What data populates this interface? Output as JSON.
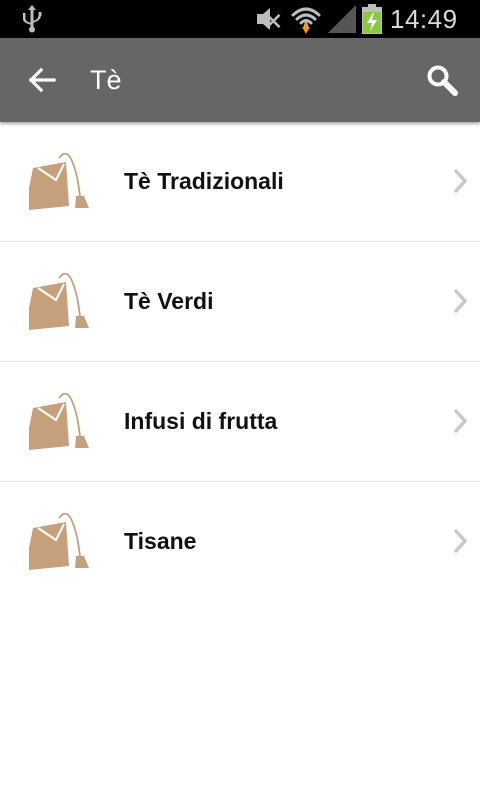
{
  "statusbar": {
    "time": "14:49",
    "icons": [
      "usb-icon",
      "mute-icon",
      "wifi-icon",
      "signal-icon",
      "battery-charging-icon"
    ]
  },
  "actionbar": {
    "title": "Tè",
    "back_icon": "arrow-left-icon",
    "search_icon": "search-icon"
  },
  "colors": {
    "statusbar_bg": "#000000",
    "actionbar_bg": "#666666",
    "teabag": "#c4a07c",
    "divider": "#e2e2e2",
    "chevron": "#c8c8c8",
    "battery_green": "#8cc83c"
  },
  "categories": [
    {
      "label": "Tè Tradizionali",
      "icon": "teabag-icon"
    },
    {
      "label": "Tè Verdi",
      "icon": "teabag-icon"
    },
    {
      "label": "Infusi di frutta",
      "icon": "teabag-icon"
    },
    {
      "label": "Tisane",
      "icon": "teabag-icon"
    }
  ]
}
